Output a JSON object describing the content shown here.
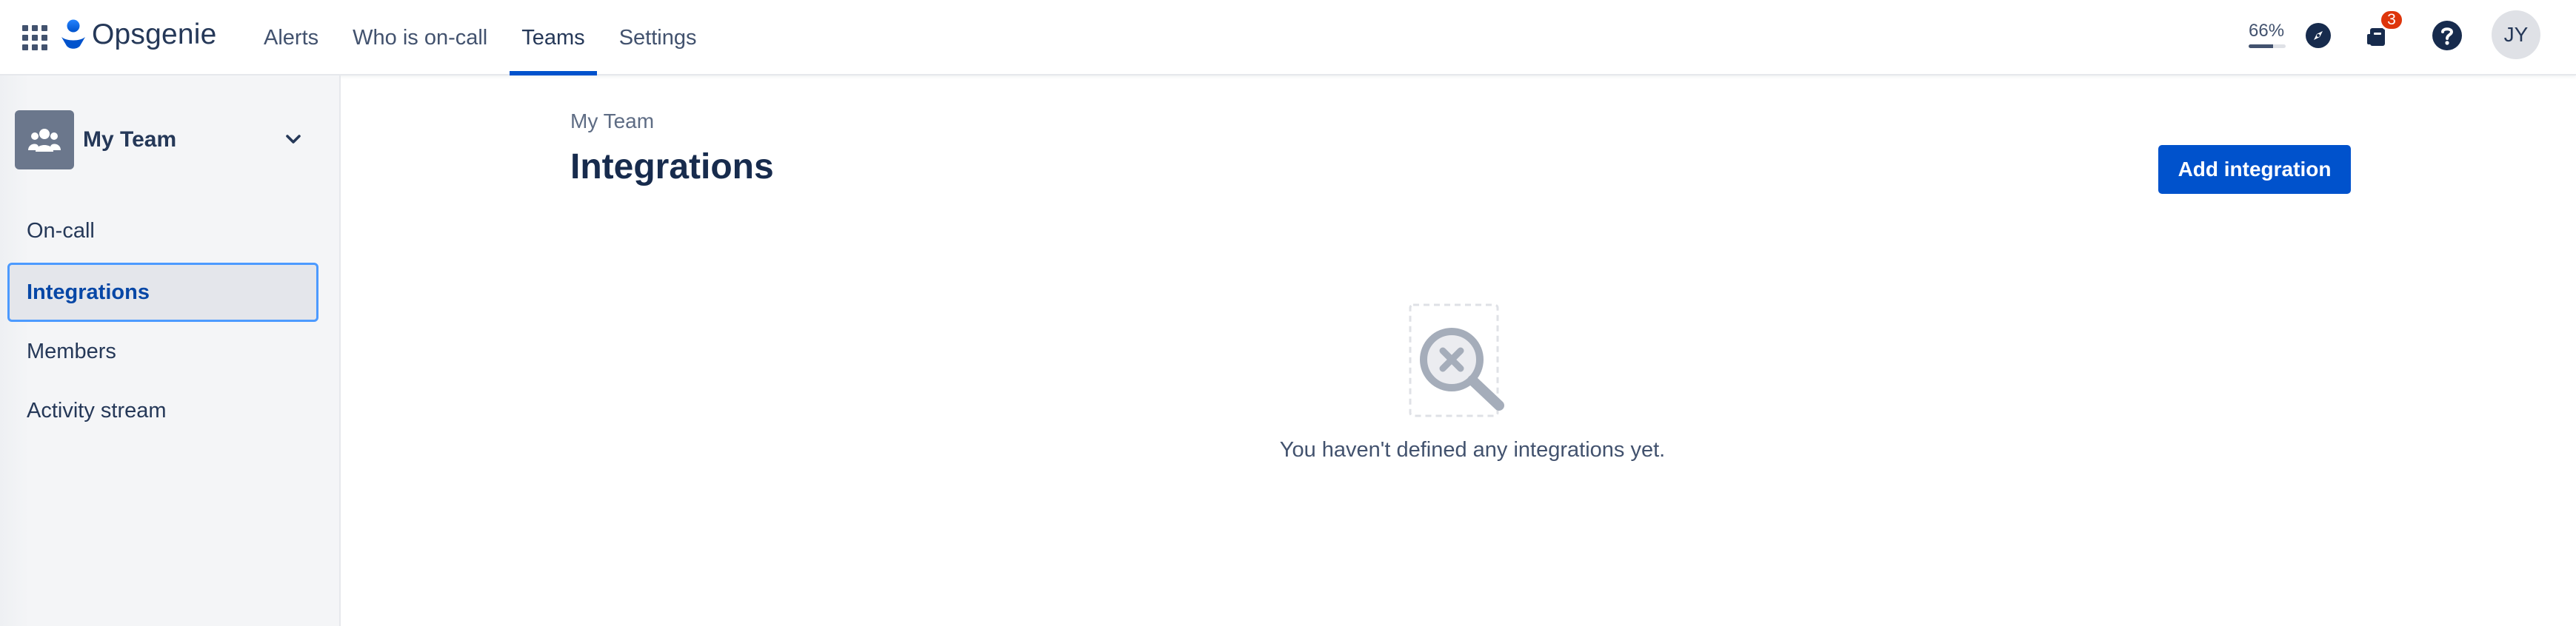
{
  "app": {
    "name": "Opsgenie"
  },
  "nav": {
    "items": [
      {
        "label": "Alerts",
        "active": false
      },
      {
        "label": "Who is on-call",
        "active": false
      },
      {
        "label": "Teams",
        "active": true
      },
      {
        "label": "Settings",
        "active": false
      }
    ]
  },
  "tools": {
    "progress_text": "66%",
    "progress_value": 0.66,
    "notification_count": "3",
    "user_initials": "JY",
    "icons": [
      "app-switcher-icon",
      "compass-icon",
      "notification-icon",
      "help-icon"
    ]
  },
  "sidebar": {
    "team_name": "My Team",
    "items": [
      {
        "label": "On-call",
        "active": false
      },
      {
        "label": "Integrations",
        "active": true
      },
      {
        "label": "Members",
        "active": false
      },
      {
        "label": "Activity stream",
        "active": false
      }
    ]
  },
  "main": {
    "breadcrumb": "My Team",
    "title": "Integrations",
    "add_button_label": "Add integration",
    "empty_message": "You haven't defined any integrations yet."
  },
  "colors": {
    "brand_blue": "#0052cc",
    "active_border": "#4c9aff",
    "badge_red": "#de350b",
    "text_dark": "#172b4d"
  }
}
